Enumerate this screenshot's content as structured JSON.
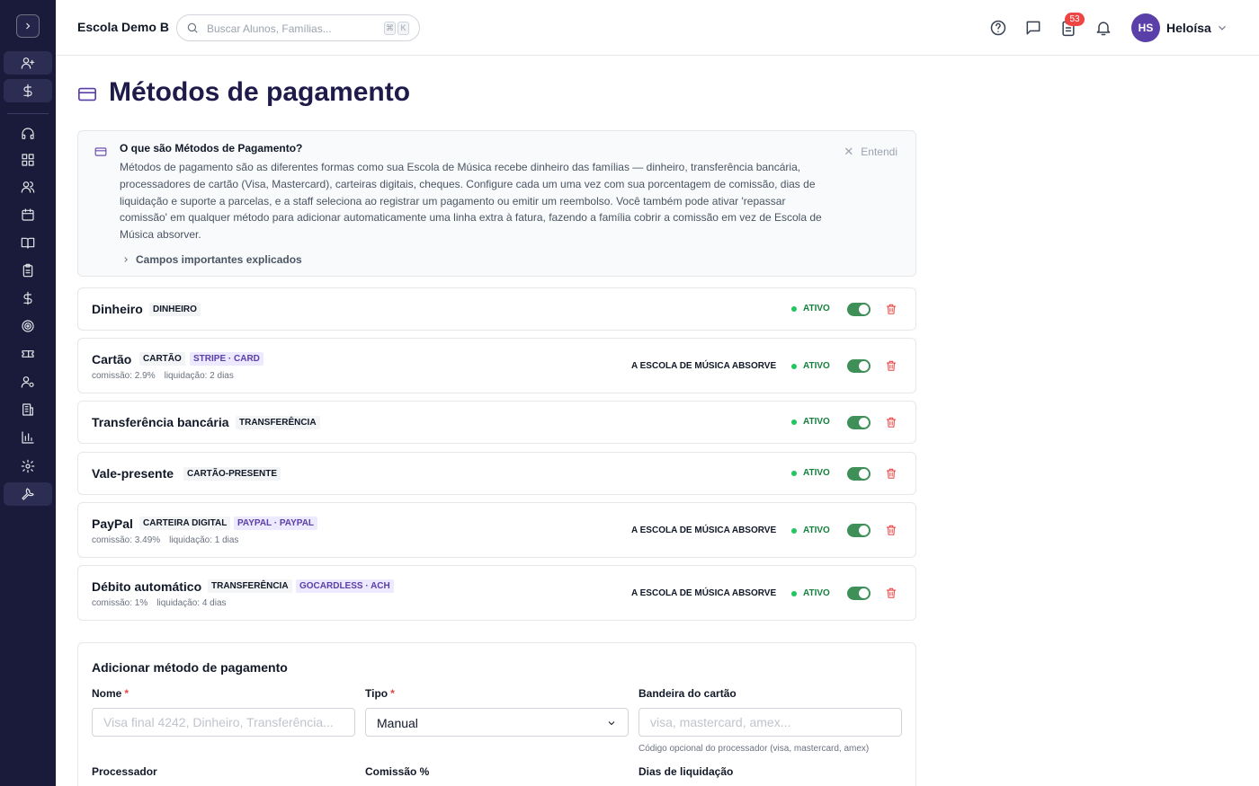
{
  "topbar": {
    "school": "Escola Demo B",
    "search_placeholder": "Buscar Alunos, Famílias...",
    "search_kbd": [
      "⌘",
      "K"
    ],
    "notification_count": "53",
    "user_initials": "HS",
    "user_name": "Heloísa"
  },
  "page": {
    "title": "Métodos de pagamento"
  },
  "info": {
    "title": "O que são Métodos de Pagamento?",
    "body": "Métodos de pagamento são as diferentes formas como sua Escola de Música recebe dinheiro das famílias — dinheiro, transferência bancária, processadores de cartão (Visa, Mastercard), carteiras digitais, cheques. Configure cada um uma vez com sua porcentagem de comissão, dias de liquidação e suporte a parcelas, e a staff seleciona ao registrar um pagamento ou emitir um reembolso. Você também pode ativar 'repassar comissão' em qualquer método para adicionar automaticamente uma linha extra à fatura, fazendo a família cobrir a comissão em vez de Escola de Música absorver.",
    "dismiss_label": "Entendi",
    "expand_label": "Campos importantes explicados"
  },
  "methods": [
    {
      "name": "Dinheiro",
      "type_tag": "DINHEIRO",
      "processor_tag": "",
      "fee": "",
      "settle": "",
      "absorb": "",
      "status": "ATIVO",
      "enabled": true
    },
    {
      "name": "Cartão",
      "type_tag": "CARTÃO",
      "processor_tag": "STRIPE · CARD",
      "fee": "comissão: 2.9%",
      "settle": "liquidação: 2 dias",
      "absorb": "A ESCOLA DE MÚSICA ABSORVE",
      "status": "ATIVO",
      "enabled": true
    },
    {
      "name": "Transferência bancária",
      "type_tag": "TRANSFERÊNCIA",
      "processor_tag": "",
      "fee": "",
      "settle": "",
      "absorb": "",
      "status": "ATIVO",
      "enabled": true
    },
    {
      "name": "Vale-presente",
      "type_tag": "CARTÃO-PRESENTE",
      "processor_tag": "",
      "fee": "",
      "settle": "",
      "absorb": "",
      "status": "ATIVO",
      "enabled": true
    },
    {
      "name": "PayPal",
      "type_tag": "CARTEIRA DIGITAL",
      "processor_tag": "PAYPAL · PAYPAL",
      "fee": "comissão: 3.49%",
      "settle": "liquidação: 1 dias",
      "absorb": "A ESCOLA DE MÚSICA ABSORVE",
      "status": "ATIVO",
      "enabled": true
    },
    {
      "name": "Débito automático",
      "type_tag": "TRANSFERÊNCIA",
      "processor_tag": "GOCARDLESS · ACH",
      "fee": "comissão: 1%",
      "settle": "liquidação: 4 dias",
      "absorb": "A ESCOLA DE MÚSICA ABSORVE",
      "status": "ATIVO",
      "enabled": true
    }
  ],
  "add_form": {
    "title": "Adicionar método de pagamento",
    "name_label": "Nome",
    "name_placeholder": "Visa final 4242, Dinheiro, Transferência...",
    "type_label": "Tipo",
    "type_value": "Manual",
    "brand_label": "Bandeira do cartão",
    "brand_placeholder": "visa, mastercard, amex...",
    "brand_help": "Código opcional do processador (visa, mastercard, amex)",
    "processor_label": "Processador",
    "fee_label": "Comissão %",
    "settle_label": "Dias de liquidação",
    "required_mark": "*"
  },
  "colors": {
    "sidebar_bg": "#1a1b3a",
    "brand": "#5b3fa8",
    "title": "#1e1b4b",
    "active_green": "#3f8f58",
    "danger": "#ef4444"
  },
  "sidebar_icons": [
    "chevron-right-icon",
    "user-plus-icon",
    "dollar-icon",
    "headset-icon",
    "grid-icon",
    "users-icon",
    "calendar-icon",
    "book-icon",
    "clipboard-icon",
    "dollar-icon",
    "target-icon",
    "ticket-icon",
    "user-gear-icon",
    "building-icon",
    "bar-chart-icon",
    "gear-icon",
    "wrench-icon"
  ]
}
